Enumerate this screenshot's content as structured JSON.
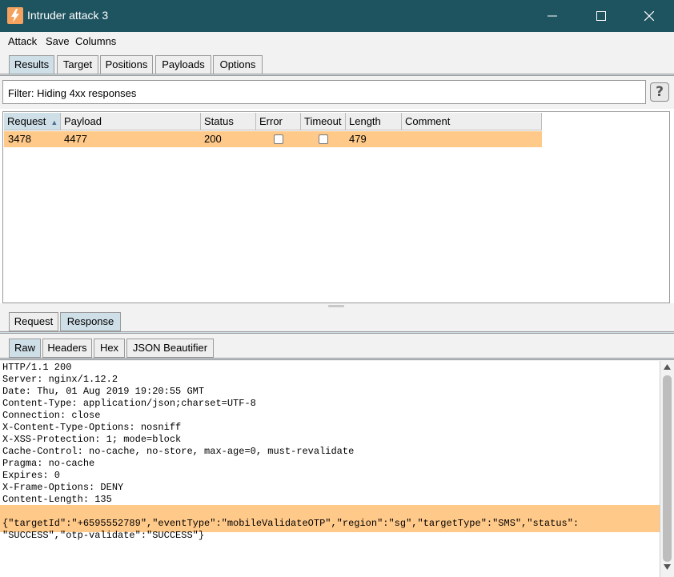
{
  "window": {
    "title": "Intruder attack 3",
    "controls": [
      "minimize-icon",
      "maximize-icon",
      "close-icon"
    ]
  },
  "menu": [
    "Attack",
    "Save",
    "Columns"
  ],
  "main_tabs": [
    {
      "label": "Results",
      "active": true
    },
    {
      "label": "Target",
      "active": false
    },
    {
      "label": "Positions",
      "active": false
    },
    {
      "label": "Payloads",
      "active": false
    },
    {
      "label": "Options",
      "active": false
    }
  ],
  "filter": {
    "text": "Filter: Hiding 4xx responses",
    "help_label": "?"
  },
  "results_table": {
    "columns": [
      "Request",
      "Payload",
      "Status",
      "Error",
      "Timeout",
      "Length",
      "Comment"
    ],
    "sorted_column": "Request",
    "rows": [
      {
        "request": "3478",
        "payload": "4477",
        "status": "200",
        "error": false,
        "timeout": false,
        "length": "479",
        "comment": ""
      }
    ]
  },
  "message_tabs": [
    {
      "label": "Request",
      "active": false
    },
    {
      "label": "Response",
      "active": true
    }
  ],
  "view_tabs": [
    {
      "label": "Raw",
      "active": true
    },
    {
      "label": "Headers",
      "active": false
    },
    {
      "label": "Hex",
      "active": false
    },
    {
      "label": "JSON Beautifier",
      "active": false
    }
  ],
  "response_lines": [
    "HTTP/1.1 200",
    "Server: nginx/1.12.2",
    "Date: Thu, 01 Aug 2019 19:20:55 GMT",
    "Content-Type: application/json;charset=UTF-8",
    "Connection: close",
    "X-Content-Type-Options: nosniff",
    "X-XSS-Protection: 1; mode=block",
    "Cache-Control: no-cache, no-store, max-age=0, must-revalidate",
    "Pragma: no-cache",
    "Expires: 0",
    "X-Frame-Options: DENY",
    "Content-Length: 135",
    "",
    "{\"targetId\":\"+6595552789\",\"eventType\":\"mobileValidateOTP\",\"region\":\"sg\",\"targetType\":\"SMS\",\"status\":",
    "\"SUCCESS\",\"otp-validate\":\"SUCCESS\"}"
  ],
  "colors": {
    "titlebar": "#1e5360",
    "highlight": "#ffc989",
    "active_tab": "#cfdfe8",
    "app_icon": "#f4a25d"
  }
}
